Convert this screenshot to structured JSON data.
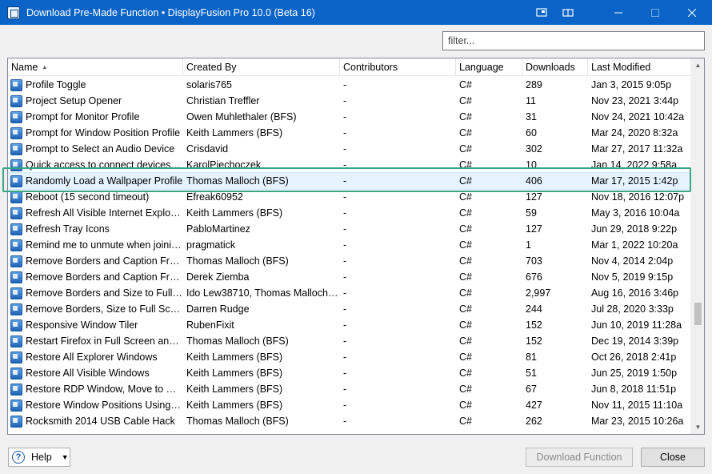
{
  "window": {
    "title": "Download Pre-Made Function • DisplayFusion Pro 10.0 (Beta 16)"
  },
  "filter": {
    "placeholder": "filter..."
  },
  "columns": [
    "Name",
    "Created By",
    "Contributors",
    "Language",
    "Downloads",
    "Last Modified"
  ],
  "sort_indicator": "▲",
  "rows": [
    {
      "name": "Profile Toggle",
      "by": "solaris765",
      "contrib": "-",
      "lang": "C#",
      "dl": "289",
      "mod": "Jan 3, 2015 9:05p"
    },
    {
      "name": "Project Setup Opener",
      "by": "Christian Treffler",
      "contrib": "-",
      "lang": "C#",
      "dl": "11",
      "mod": "Nov 23, 2021 3:44p"
    },
    {
      "name": "Prompt for Monitor Profile",
      "by": "Owen Muhlethaler (BFS)",
      "contrib": "-",
      "lang": "C#",
      "dl": "31",
      "mod": "Nov 24, 2021 10:42a"
    },
    {
      "name": "Prompt for Window Position Profile",
      "by": "Keith Lammers (BFS)",
      "contrib": "-",
      "lang": "C#",
      "dl": "60",
      "mod": "Mar 24, 2020 8:32a"
    },
    {
      "name": "Prompt to Select an Audio Device",
      "by": "Crisdavid",
      "contrib": "-",
      "lang": "C#",
      "dl": "302",
      "mod": "Mar 27, 2017 11:32a"
    },
    {
      "name": "Quick access to connect devices su...",
      "by": "KarolPiechoczek",
      "contrib": "-",
      "lang": "C#",
      "dl": "10",
      "mod": "Jan 14, 2022 9:58a"
    },
    {
      "name": "Randomly Load a Wallpaper Profile",
      "by": "Thomas Malloch (BFS)",
      "contrib": "-",
      "lang": "C#",
      "dl": "406",
      "mod": "Mar 17, 2015 1:42p"
    },
    {
      "name": "Reboot (15 second timeout)",
      "by": "Efreak60952",
      "contrib": "-",
      "lang": "C#",
      "dl": "127",
      "mod": "Nov 18, 2016 12:07p"
    },
    {
      "name": "Refresh All Visible Internet Explorer ...",
      "by": "Keith Lammers (BFS)",
      "contrib": "-",
      "lang": "C#",
      "dl": "59",
      "mod": "May 3, 2016 10:04a"
    },
    {
      "name": "Refresh Tray Icons",
      "by": "PabloMartinez",
      "contrib": "-",
      "lang": "C#",
      "dl": "127",
      "mod": "Jun 29, 2018 9:22p"
    },
    {
      "name": "Remind me to unmute when joinin...",
      "by": "pragmatick",
      "contrib": "-",
      "lang": "C#",
      "dl": "1",
      "mod": "Mar 1, 2022 10:20a"
    },
    {
      "name": "Remove Borders and Caption From...",
      "by": "Thomas Malloch (BFS)",
      "contrib": "-",
      "lang": "C#",
      "dl": "703",
      "mod": "Nov 4, 2014 2:04p"
    },
    {
      "name": "Remove Borders and Caption From...",
      "by": "Derek Ziemba",
      "contrib": "-",
      "lang": "C#",
      "dl": "676",
      "mod": "Nov 5, 2019 9:15p"
    },
    {
      "name": "Remove Borders and Size to Full Sc...",
      "by": "Ido Lew38710, Thomas Malloch (B...",
      "contrib": "-",
      "lang": "C#",
      "dl": "2,997",
      "mod": "Aug 16, 2016 3:46p"
    },
    {
      "name": "Remove Borders, Size to Full Screen...",
      "by": "Darren Rudge",
      "contrib": "-",
      "lang": "C#",
      "dl": "244",
      "mod": "Jul 28, 2020 3:33p"
    },
    {
      "name": "Responsive Window Tiler",
      "by": "RubenFixit",
      "contrib": "-",
      "lang": "C#",
      "dl": "152",
      "mod": "Jun 10, 2019 11:28a"
    },
    {
      "name": "Restart Firefox in Full Screen and S...",
      "by": "Thomas Malloch (BFS)",
      "contrib": "-",
      "lang": "C#",
      "dl": "152",
      "mod": "Dec 19, 2014 3:39p"
    },
    {
      "name": "Restore All Explorer Windows",
      "by": "Keith Lammers (BFS)",
      "contrib": "-",
      "lang": "C#",
      "dl": "81",
      "mod": "Oct 26, 2018 2:41p"
    },
    {
      "name": "Restore All Visible Windows",
      "by": "Keith Lammers (BFS)",
      "contrib": "-",
      "lang": "C#",
      "dl": "51",
      "mod": "Jun 25, 2019 1:50p"
    },
    {
      "name": "Restore RDP Window, Move to Nex...",
      "by": "Keith Lammers (BFS)",
      "contrib": "-",
      "lang": "C#",
      "dl": "67",
      "mod": "Jun 8, 2018 11:51p"
    },
    {
      "name": "Restore Window Positions Using W...",
      "by": "Keith Lammers (BFS)",
      "contrib": "-",
      "lang": "C#",
      "dl": "427",
      "mod": "Nov 11, 2015 11:10a"
    },
    {
      "name": "Rocksmith 2014 USB Cable Hack",
      "by": "Thomas Malloch (BFS)",
      "contrib": "-",
      "lang": "C#",
      "dl": "262",
      "mod": "Mar 23, 2015 10:26a"
    }
  ],
  "selected_row": 6,
  "buttons": {
    "help": "Help",
    "download": "Download Function",
    "close": "Close"
  }
}
